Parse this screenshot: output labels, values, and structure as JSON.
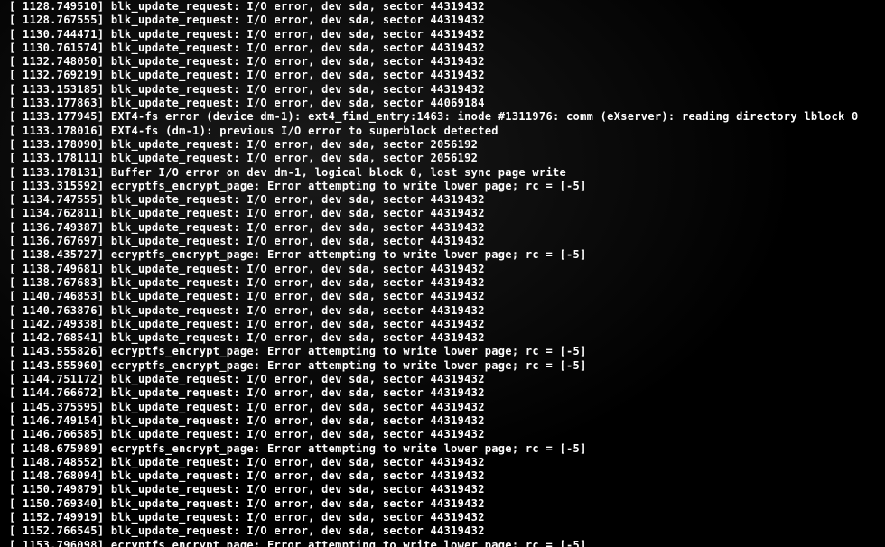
{
  "lines": [
    {
      "ts": "1128.749510",
      "msg": "blk_update_request: I/O error, dev sda, sector 44319432"
    },
    {
      "ts": "1128.767555",
      "msg": "blk_update_request: I/O error, dev sda, sector 44319432"
    },
    {
      "ts": "1130.744471",
      "msg": "blk_update_request: I/O error, dev sda, sector 44319432"
    },
    {
      "ts": "1130.761574",
      "msg": "blk_update_request: I/O error, dev sda, sector 44319432"
    },
    {
      "ts": "1132.748050",
      "msg": "blk_update_request: I/O error, dev sda, sector 44319432"
    },
    {
      "ts": "1132.769219",
      "msg": "blk_update_request: I/O error, dev sda, sector 44319432"
    },
    {
      "ts": "1133.153185",
      "msg": "blk_update_request: I/O error, dev sda, sector 44319432"
    },
    {
      "ts": "1133.177863",
      "msg": "blk_update_request: I/O error, dev sda, sector 44069184"
    },
    {
      "ts": "1133.177945",
      "msg": "EXT4-fs error (device dm-1): ext4_find_entry:1463: inode #1311976: comm (eXserver): reading directory lblock 0"
    },
    {
      "ts": "1133.178016",
      "msg": "EXT4-fs (dm-1): previous I/O error to superblock detected"
    },
    {
      "ts": "1133.178090",
      "msg": "blk_update_request: I/O error, dev sda, sector 2056192"
    },
    {
      "ts": "1133.178111",
      "msg": "blk_update_request: I/O error, dev sda, sector 2056192"
    },
    {
      "ts": "1133.178131",
      "msg": "Buffer I/O error on dev dm-1, logical block 0, lost sync page write"
    },
    {
      "ts": "1133.315592",
      "msg": "ecryptfs_encrypt_page: Error attempting to write lower page; rc = [-5]"
    },
    {
      "ts": "1134.747555",
      "msg": "blk_update_request: I/O error, dev sda, sector 44319432"
    },
    {
      "ts": "1134.762811",
      "msg": "blk_update_request: I/O error, dev sda, sector 44319432"
    },
    {
      "ts": "1136.749387",
      "msg": "blk_update_request: I/O error, dev sda, sector 44319432"
    },
    {
      "ts": "1136.767697",
      "msg": "blk_update_request: I/O error, dev sda, sector 44319432"
    },
    {
      "ts": "1138.435727",
      "msg": "ecryptfs_encrypt_page: Error attempting to write lower page; rc = [-5]"
    },
    {
      "ts": "1138.749681",
      "msg": "blk_update_request: I/O error, dev sda, sector 44319432"
    },
    {
      "ts": "1138.767683",
      "msg": "blk_update_request: I/O error, dev sda, sector 44319432"
    },
    {
      "ts": "1140.746853",
      "msg": "blk_update_request: I/O error, dev sda, sector 44319432"
    },
    {
      "ts": "1140.763876",
      "msg": "blk_update_request: I/O error, dev sda, sector 44319432"
    },
    {
      "ts": "1142.749338",
      "msg": "blk_update_request: I/O error, dev sda, sector 44319432"
    },
    {
      "ts": "1142.768541",
      "msg": "blk_update_request: I/O error, dev sda, sector 44319432"
    },
    {
      "ts": "1143.555826",
      "msg": "ecryptfs_encrypt_page: Error attempting to write lower page; rc = [-5]"
    },
    {
      "ts": "1143.555960",
      "msg": "ecryptfs_encrypt_page: Error attempting to write lower page; rc = [-5]"
    },
    {
      "ts": "1144.751172",
      "msg": "blk_update_request: I/O error, dev sda, sector 44319432"
    },
    {
      "ts": "1144.766672",
      "msg": "blk_update_request: I/O error, dev sda, sector 44319432"
    },
    {
      "ts": "1145.375595",
      "msg": "blk_update_request: I/O error, dev sda, sector 44319432"
    },
    {
      "ts": "1146.749154",
      "msg": "blk_update_request: I/O error, dev sda, sector 44319432"
    },
    {
      "ts": "1146.766585",
      "msg": "blk_update_request: I/O error, dev sda, sector 44319432"
    },
    {
      "ts": "1148.675989",
      "msg": "ecryptfs_encrypt_page: Error attempting to write lower page; rc = [-5]"
    },
    {
      "ts": "1148.748552",
      "msg": "blk_update_request: I/O error, dev sda, sector 44319432"
    },
    {
      "ts": "1148.768094",
      "msg": "blk_update_request: I/O error, dev sda, sector 44319432"
    },
    {
      "ts": "1150.749879",
      "msg": "blk_update_request: I/O error, dev sda, sector 44319432"
    },
    {
      "ts": "1150.769340",
      "msg": "blk_update_request: I/O error, dev sda, sector 44319432"
    },
    {
      "ts": "1152.749919",
      "msg": "blk_update_request: I/O error, dev sda, sector 44319432"
    },
    {
      "ts": "1152.766545",
      "msg": "blk_update_request: I/O error, dev sda, sector 44319432"
    },
    {
      "ts": "1153.796098",
      "msg": "ecryptfs_encrypt_page: Error attempting to write lower page; rc = [-5]"
    }
  ]
}
